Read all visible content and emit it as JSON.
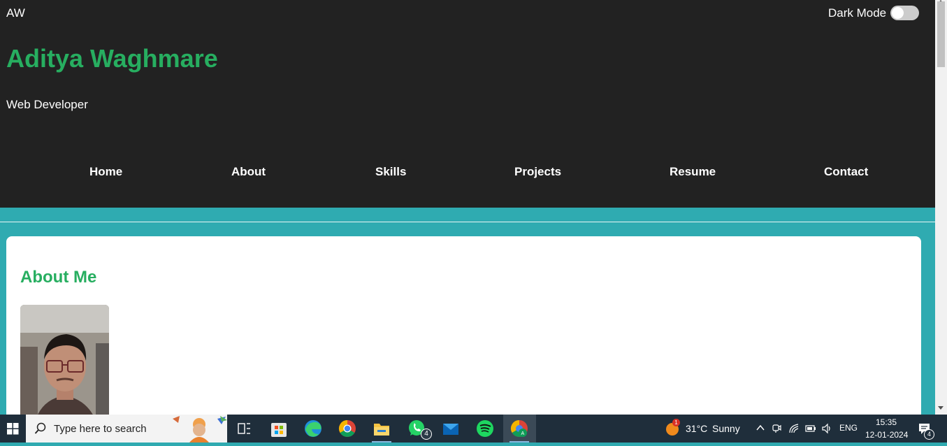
{
  "header": {
    "logo": "AW",
    "dark_mode_label": "Dark Mode",
    "dark_mode_on": false,
    "name": "Aditya Waghmare",
    "tagline": "Web Developer",
    "nav": [
      "Home",
      "About",
      "Skills",
      "Projects",
      "Resume",
      "Contact"
    ]
  },
  "about": {
    "title": "About Me"
  },
  "taskbar": {
    "search_placeholder": "Type here to search",
    "apps": [
      "task-view",
      "microsoft-store",
      "edge",
      "chrome",
      "file-explorer",
      "whatsapp",
      "mail",
      "spotify",
      "chrome-profile"
    ],
    "whatsapp_badge": "4",
    "weather_badge": "1",
    "temperature": "31°C",
    "weather": "Sunny",
    "language": "ENG",
    "time": "15:35",
    "date": "12-01-2024",
    "notification_count": "4"
  },
  "colors": {
    "accent": "#27ae60",
    "header_bg": "#222222",
    "page_bg": "#2faab0"
  }
}
